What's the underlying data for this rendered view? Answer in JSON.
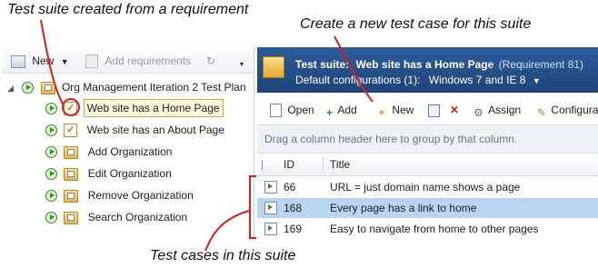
{
  "callouts": {
    "suite_from_requirement": "Test suite created from a requirement",
    "new_test_case": "Create a new test case for this suite",
    "test_cases_in_suite": "Test cases in this suite"
  },
  "left_toolbar": {
    "new_label": "New",
    "add_requirements_label": "Add requirements"
  },
  "tree": {
    "root": "Org Management Iteration 2 Test Plan",
    "items": [
      "Web site has a Home Page",
      "Web site has an About Page",
      "Add Organization",
      "Edit Organization",
      "Remove Organization",
      "Search Organization"
    ]
  },
  "suite_header": {
    "prefix": "Test suite:",
    "name": "Web site has a Home Page",
    "requirement": "(Requirement 81)",
    "config_label": "Default configurations (1):",
    "config_value": "Windows 7 and IE 8"
  },
  "right_toolbar": {
    "open": "Open",
    "add": "Add",
    "new": "New",
    "assign": "Assign",
    "configure": "Configura"
  },
  "group_hint": "Drag a column header here to group by that column.",
  "grid": {
    "columns": [
      "ID",
      "Title"
    ],
    "rows": [
      {
        "id": "66",
        "title": "URL = just domain name shows a page"
      },
      {
        "id": "168",
        "title": "Every page has a link to home"
      },
      {
        "id": "169",
        "title": "Easy to navigate from home to other pages"
      }
    ]
  }
}
